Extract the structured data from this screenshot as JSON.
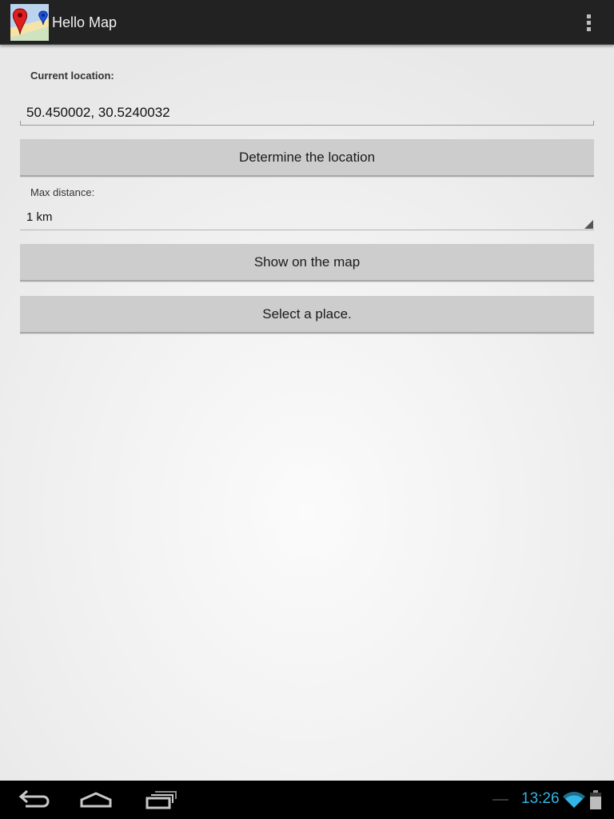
{
  "action_bar": {
    "title": "Hello Map",
    "icons": {
      "app": "map-pin-app-icon",
      "menu": "overflow-menu-icon"
    }
  },
  "form": {
    "current_location_label": "Current location:",
    "current_location_value": "50.450002, 30.5240032",
    "determine_button": "Determine the location",
    "max_distance_label": "Max distance:",
    "max_distance_value": "1 km",
    "show_map_button": "Show on the map",
    "select_place_button": "Select a place."
  },
  "system_bar": {
    "time": "13:26",
    "icons": [
      "back-icon",
      "home-icon",
      "recent-apps-icon",
      "wifi-icon",
      "battery-icon"
    ],
    "accent_color": "#33b5e5"
  }
}
